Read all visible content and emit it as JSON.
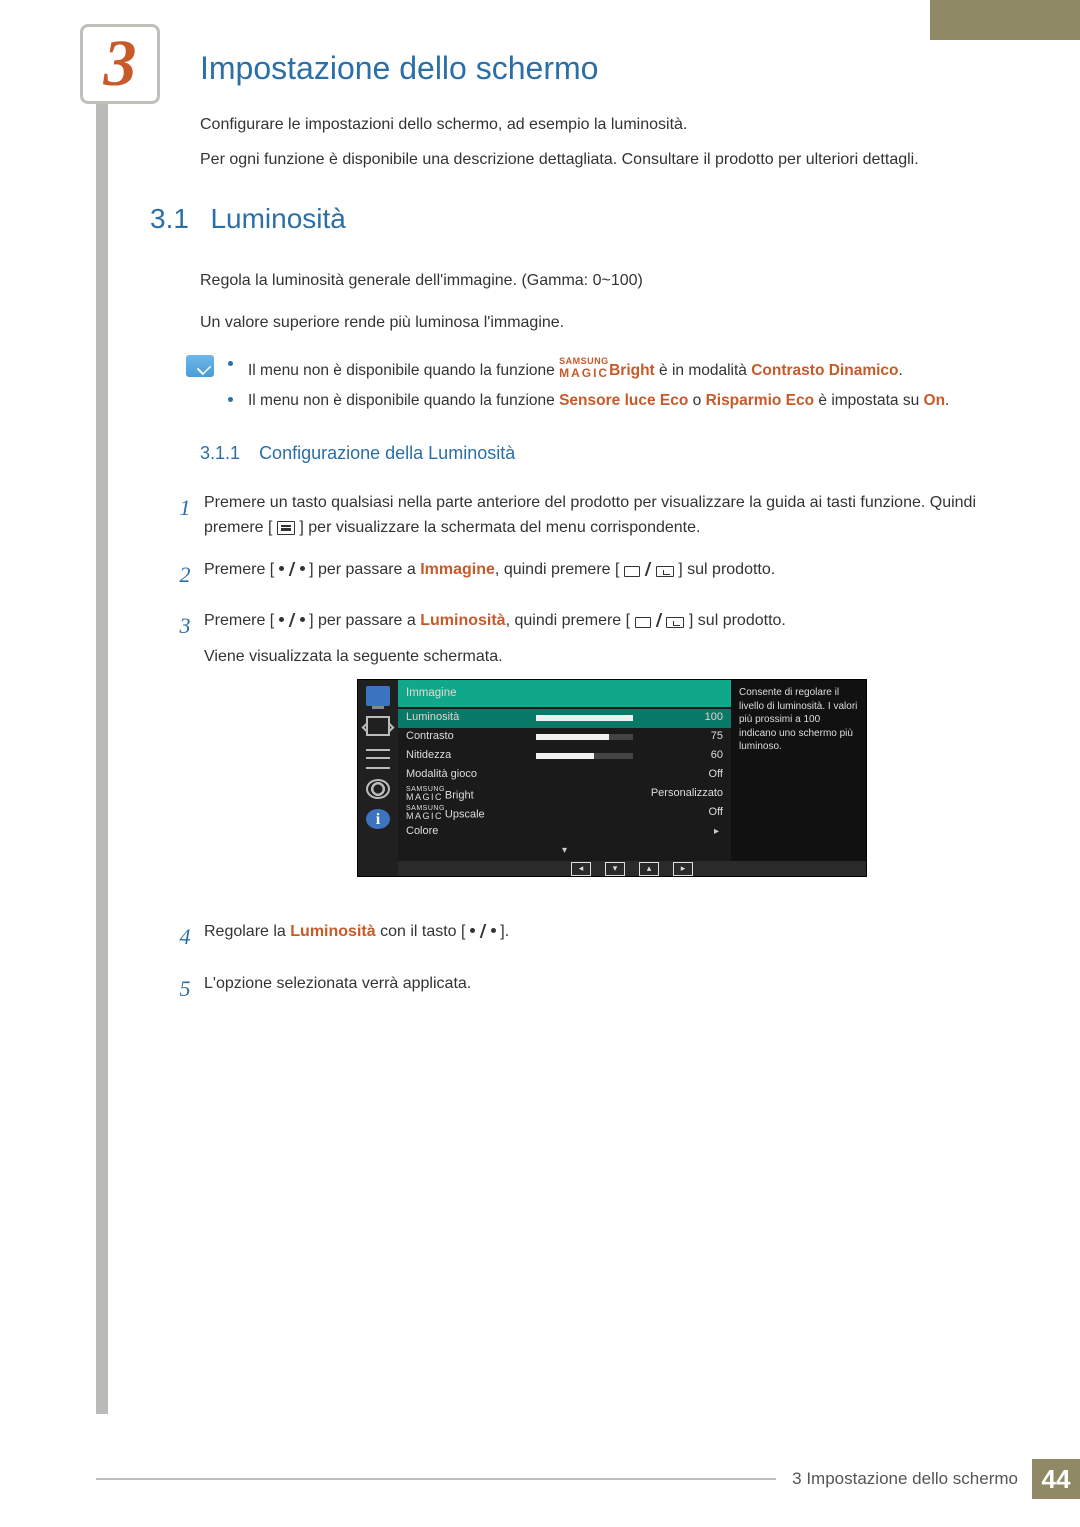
{
  "chapter_number": "3",
  "chapter_title": "Impostazione dello schermo",
  "intro1": "Configurare le impostazioni dello schermo, ad esempio la luminosità.",
  "intro2": "Per ogni funzione è disponibile una descrizione dettagliata. Consultare il prodotto per ulteriori dettagli.",
  "section": {
    "num": "3.1",
    "title": "Luminosità"
  },
  "p1": "Regola la luminosità generale dell'immagine. (Gamma: 0~100)",
  "p2": "Un valore superiore rende più luminosa l'immagine.",
  "note1": {
    "pre": "Il menu non è disponibile quando la funzione ",
    "magic_sup": "SAMSUNG",
    "magic_main": "MAGIC",
    "magic_suffix": "Bright",
    "mid": " è in modalità ",
    "hl": "Contrasto Dinamico",
    "post": "."
  },
  "note2": {
    "pre": "Il menu non è disponibile quando la funzione ",
    "hl1": "Sensore luce Eco",
    "or": " o ",
    "hl2": "Risparmio Eco",
    "mid": " è impostata su ",
    "hl3": "On",
    "post": "."
  },
  "subsection": {
    "num": "3.1.1",
    "title": "Configurazione della Luminosità"
  },
  "steps": {
    "s1a": "Premere un tasto qualsiasi nella parte anteriore del prodotto per visualizzare la guida ai tasti funzione. Quindi premere [",
    "s1b": "] per visualizzare la schermata del menu corrispondente.",
    "s2a": "Premere [",
    "s2b": "] per passare a ",
    "s2hl": "Immagine",
    "s2c": ", quindi premere [",
    "s2d": "] sul prodotto.",
    "s3a": "Premere [",
    "s3b": "] per passare a ",
    "s3hl": "Luminosità",
    "s3c": ", quindi premere [",
    "s3d": "] sul prodotto.",
    "s3e": "Viene visualizzata la seguente schermata.",
    "s4a": "Regolare la ",
    "s4hl": "Luminosità",
    "s4b": " con il tasto [",
    "s4c": "].",
    "s5": "L'opzione selezionata verrà applicata."
  },
  "osd": {
    "header": "Immagine",
    "info": "Consente di regolare il livello di luminosità. I valori più prossimi a 100 indicano uno schermo più luminoso.",
    "magic_sup": "SAMSUNG",
    "magic_main": "MAGIC",
    "rows": [
      {
        "label": "Luminosità",
        "value": "100",
        "bar": 100,
        "selected": true
      },
      {
        "label": "Contrasto",
        "value": "75",
        "bar": 75
      },
      {
        "label": "Nitidezza",
        "value": "60",
        "bar": 60
      },
      {
        "label": "Modalità gioco",
        "value": "Off"
      },
      {
        "label_magic": "Bright",
        "value": "Personalizzato"
      },
      {
        "label_magic": "Upscale",
        "value": "Off"
      },
      {
        "label": "Colore"
      }
    ]
  },
  "footer": {
    "text": "3 Impostazione dello schermo",
    "page": "44"
  },
  "info_char": "i"
}
